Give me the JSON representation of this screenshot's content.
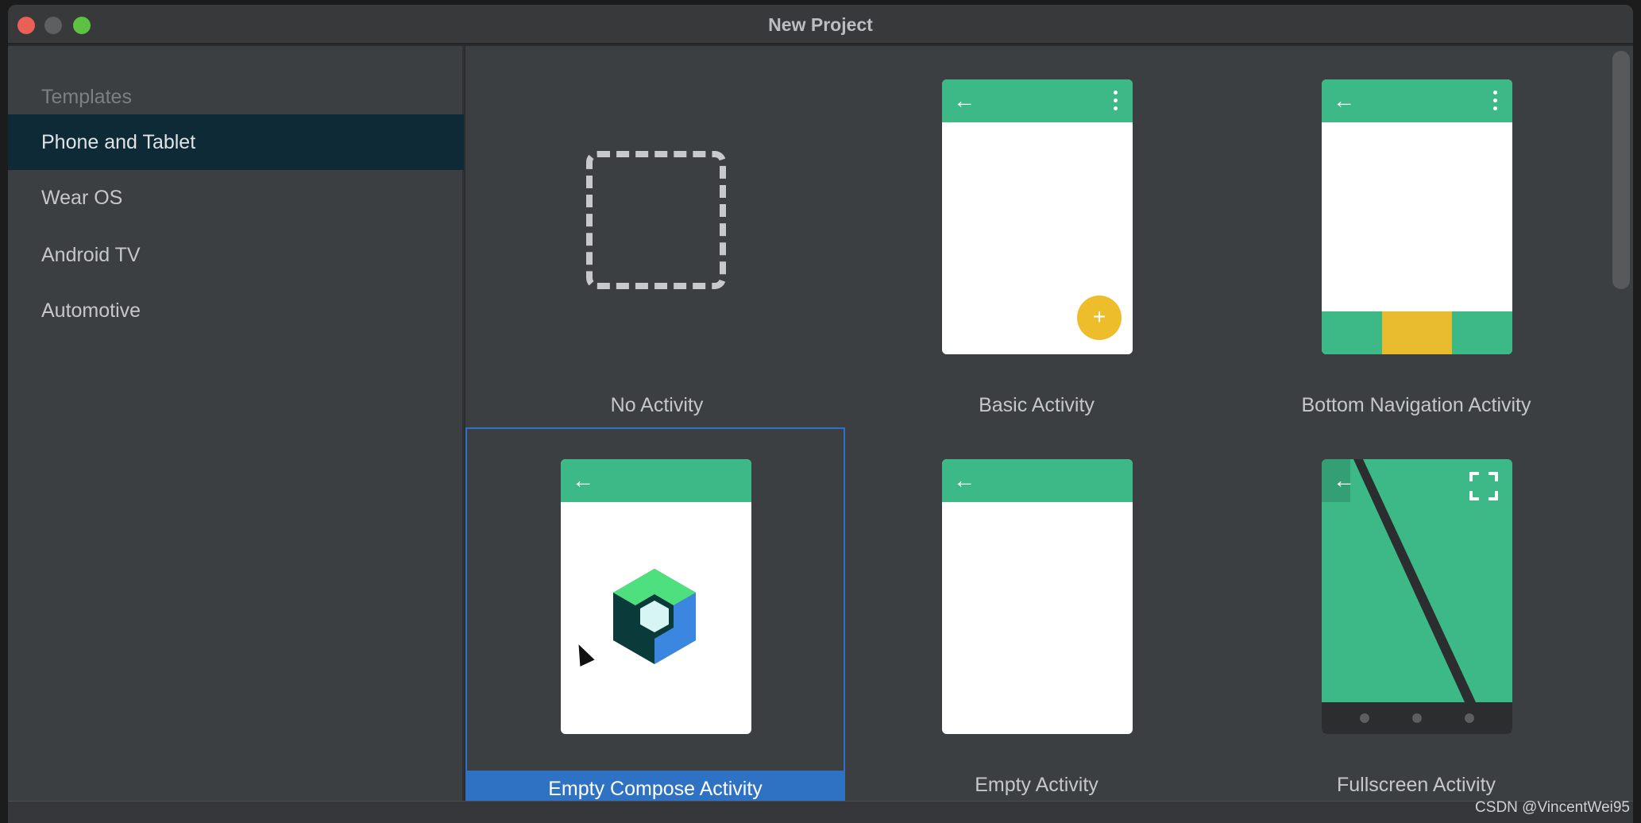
{
  "window": {
    "title": "New Project"
  },
  "sidebar": {
    "heading": "Templates",
    "items": [
      {
        "label": "Phone and Tablet",
        "selected": true
      },
      {
        "label": "Wear OS",
        "selected": false
      },
      {
        "label": "Android TV",
        "selected": false
      },
      {
        "label": "Automotive",
        "selected": false
      }
    ]
  },
  "templates": [
    {
      "label": "No Activity",
      "selected": false
    },
    {
      "label": "Basic Activity",
      "selected": false
    },
    {
      "label": "Bottom Navigation Activity",
      "selected": false
    },
    {
      "label": "Empty Compose Activity",
      "selected": true
    },
    {
      "label": "Empty Activity",
      "selected": false
    },
    {
      "label": "Fullscreen Activity",
      "selected": false
    }
  ],
  "icons": {
    "back": "arrow-left-icon",
    "menu": "more-vert-icon",
    "fab": "plus-icon",
    "fullscreen": "fullscreen-icon",
    "compose": "jetpack-compose-logo-icon"
  },
  "colors": {
    "accent_green": "#3db887",
    "fab_yellow": "#edbd2c",
    "selection_blue": "#2f72c4"
  },
  "watermark": "CSDN @VincentWei95"
}
